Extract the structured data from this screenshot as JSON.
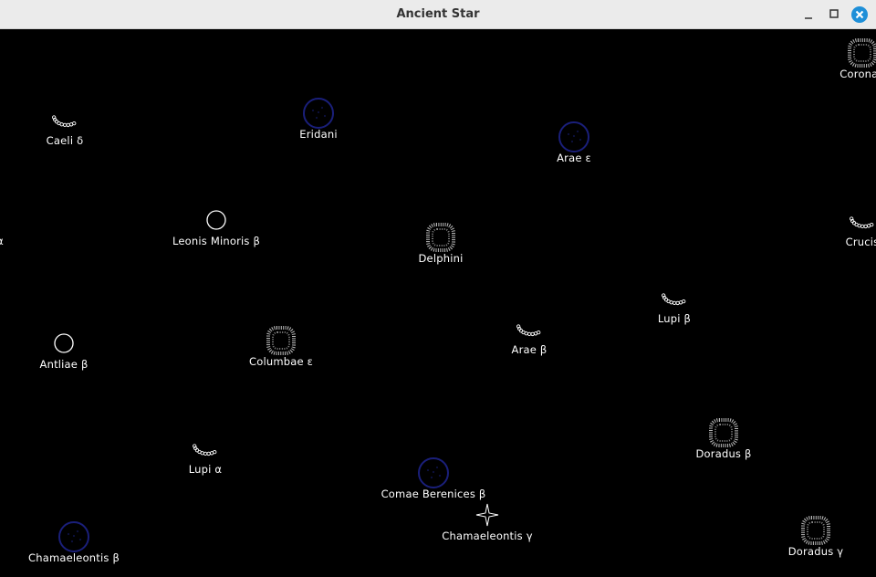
{
  "window": {
    "title": "Ancient Star"
  },
  "colors": {
    "background": "#000000",
    "label": "#ffffff",
    "titlebar": "#ebebeb",
    "close_button": "#1e8fd8",
    "dark_planet_ring": "#1a1f7a"
  },
  "stars": [
    {
      "name": "Caeli δ",
      "icon": "crescent-chain-icon"
    },
    {
      "name": "Eridani",
      "icon": "dark-planet-icon"
    },
    {
      "name": "Arae ε",
      "icon": "dark-planet-icon"
    },
    {
      "name": "Coronae",
      "icon": "dotted-ring-icon"
    },
    {
      "name": "Leonis Minoris β",
      "icon": "hollow-circle-icon"
    },
    {
      "name": "Delphini",
      "icon": "dotted-ring-icon"
    },
    {
      "name": "Crucis",
      "icon": "crescent-chain-icon"
    },
    {
      "name": "α",
      "icon": "none"
    },
    {
      "name": "Lupi β",
      "icon": "crescent-chain-icon"
    },
    {
      "name": "Antliae β",
      "icon": "hollow-circle-icon"
    },
    {
      "name": "Columbae ε",
      "icon": "dotted-ring-icon"
    },
    {
      "name": "Arae β",
      "icon": "crescent-chain-icon"
    },
    {
      "name": "Doradus β",
      "icon": "dotted-ring-icon"
    },
    {
      "name": "Lupi α",
      "icon": "crescent-chain-icon"
    },
    {
      "name": "Comae Berenices β",
      "icon": "dark-planet-icon"
    },
    {
      "name": "Chamaeleontis γ",
      "icon": "four-point-star-icon"
    },
    {
      "name": "Chamaeleontis β",
      "icon": "dark-planet-icon"
    },
    {
      "name": "Doradus γ",
      "icon": "dotted-ring-icon"
    }
  ]
}
